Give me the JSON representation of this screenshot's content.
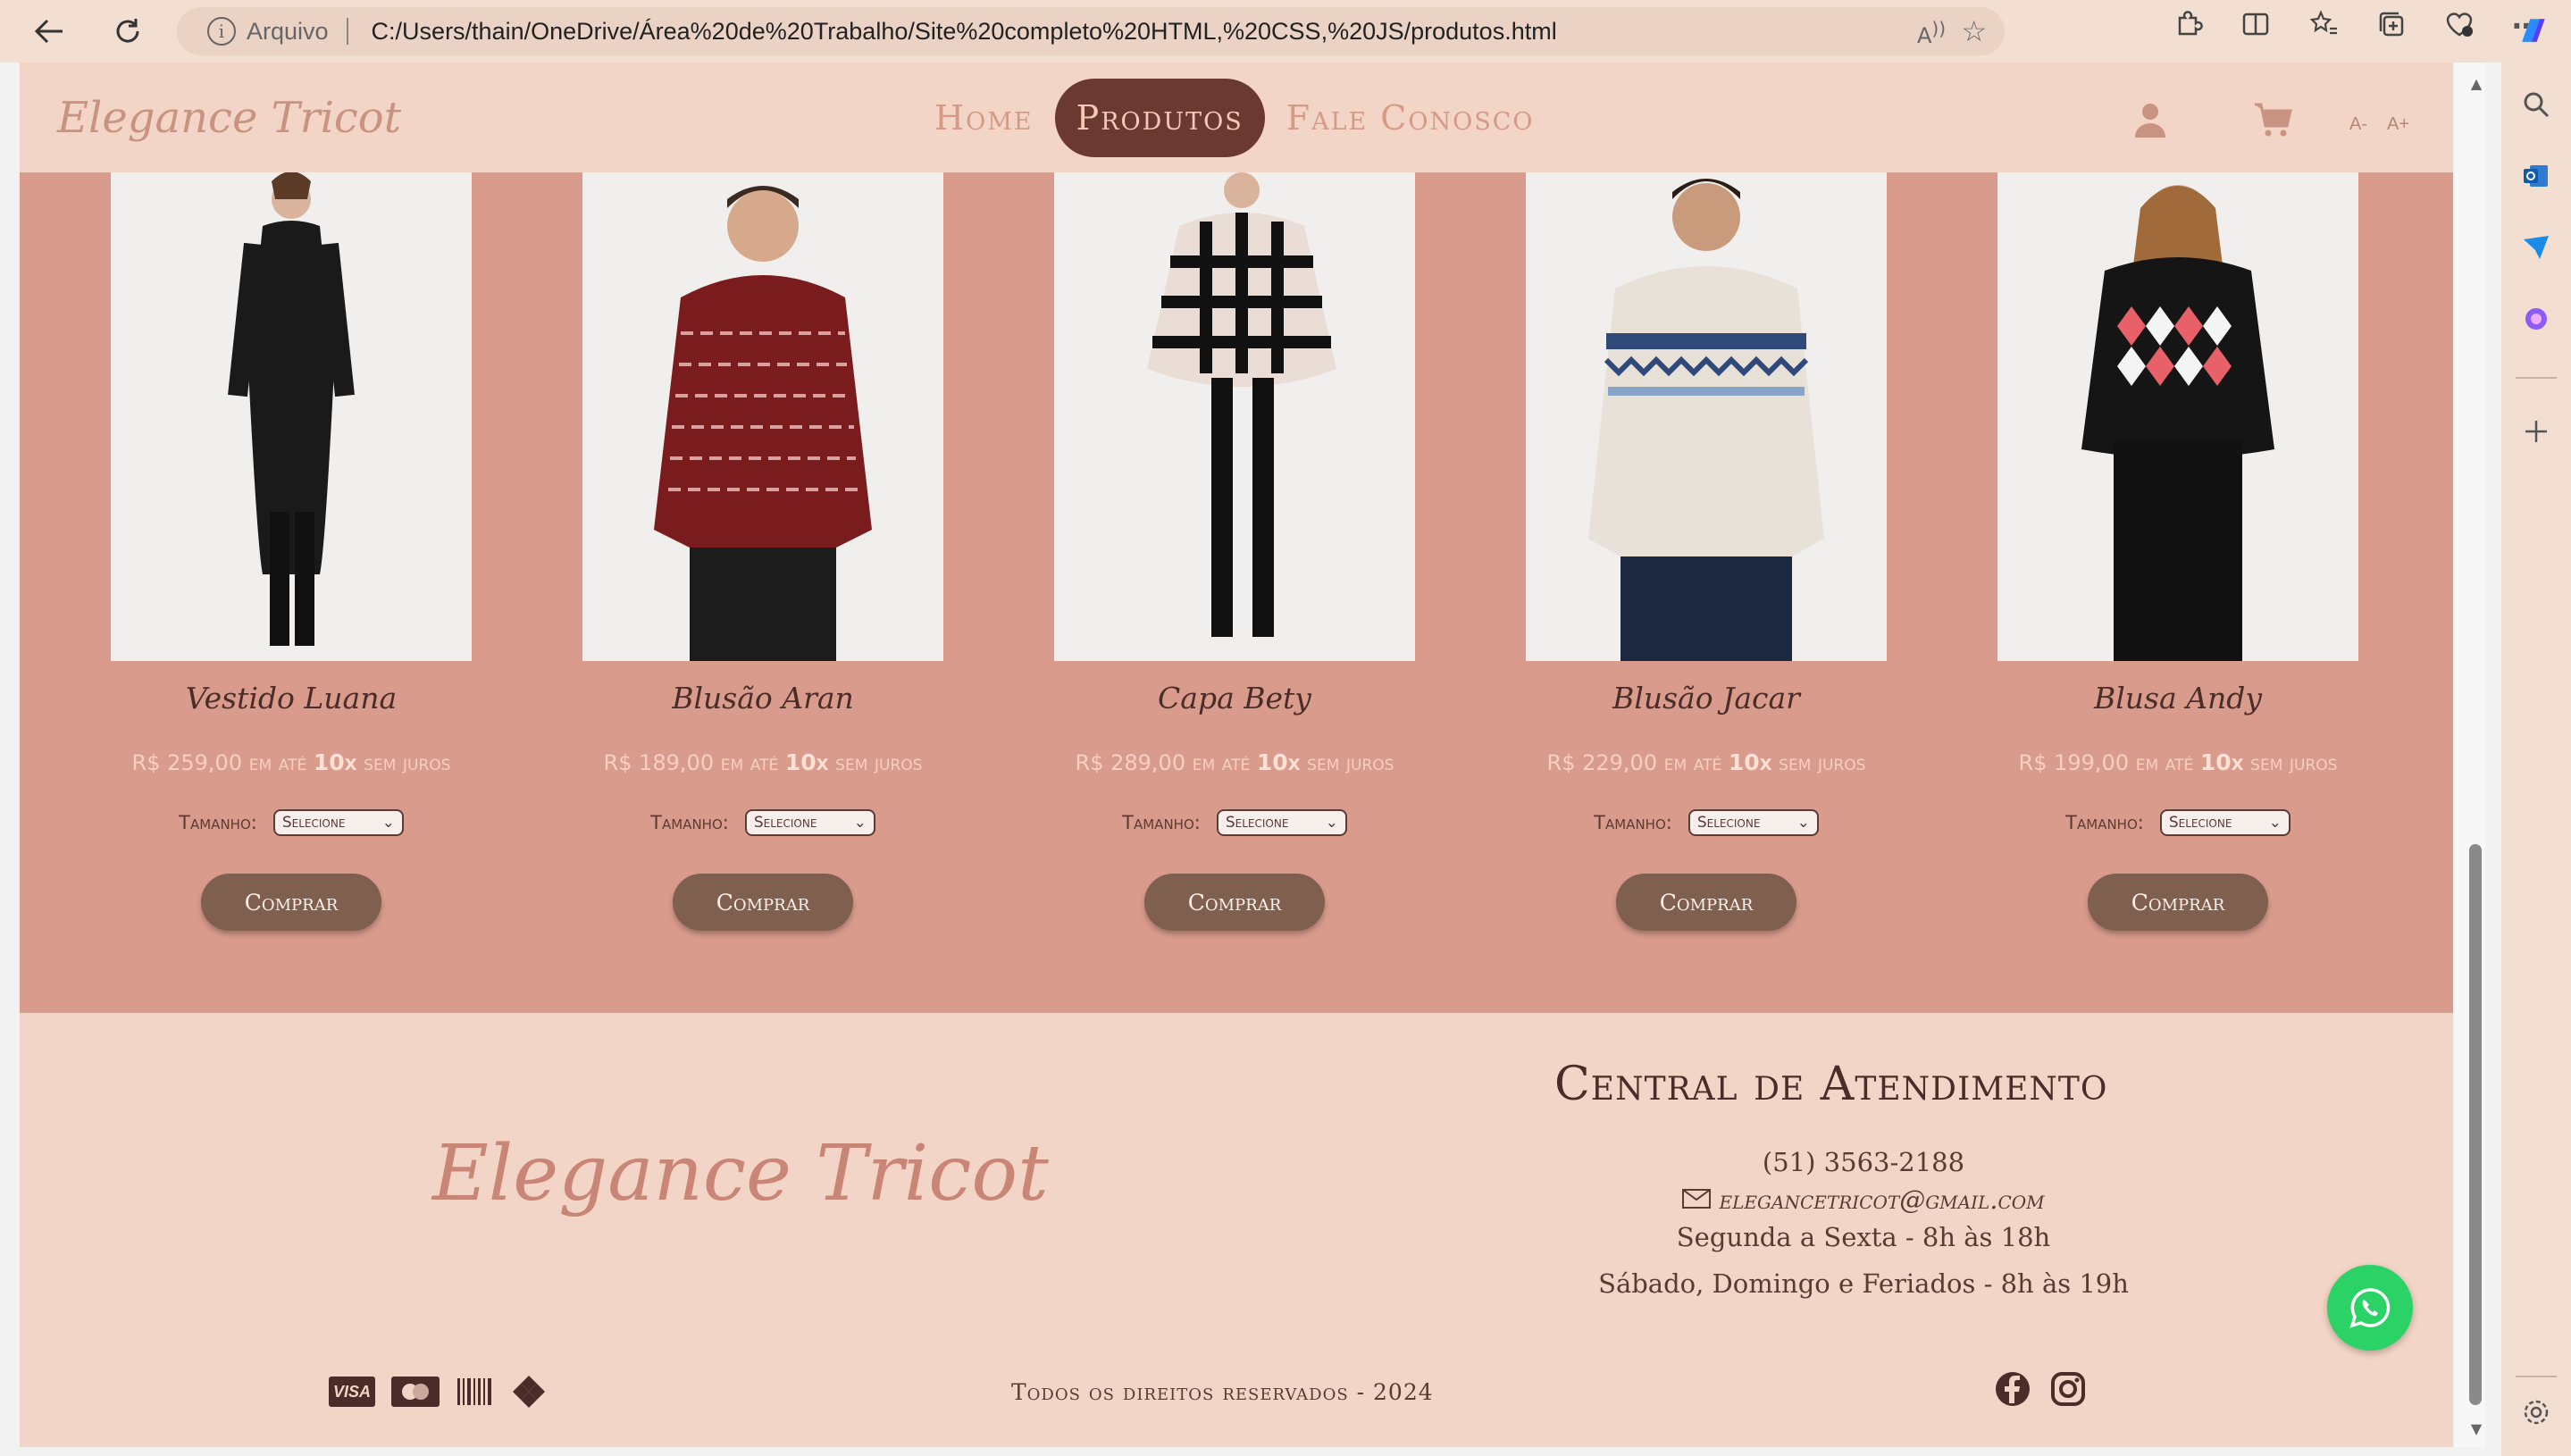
{
  "browser": {
    "address_label": "Arquivo",
    "url": "C:/Users/thain/OneDrive/Área%20de%20Trabalho/Site%20completo%20HTML,%20CSS,%20JS/produtos.html"
  },
  "header": {
    "logo": "Elegance Tricot",
    "nav": [
      {
        "label": "Home"
      },
      {
        "label": "Produtos"
      },
      {
        "label": "Fale Conosco"
      }
    ],
    "font_decrease": "A-",
    "font_increase": "A+"
  },
  "products": [
    {
      "name": "Vestido Luana",
      "price": "R$ 259,00",
      "installments_prefix": "em até",
      "installments": "10x",
      "installments_suffix": "sem juros",
      "size_label": "Tamanho:",
      "size_value": "Selecione",
      "buy_label": "Comprar"
    },
    {
      "name": "Blusão Aran",
      "price": "R$ 189,00",
      "installments_prefix": "em até",
      "installments": "10x",
      "installments_suffix": "sem juros",
      "size_label": "Tamanho:",
      "size_value": "Selecione",
      "buy_label": "Comprar"
    },
    {
      "name": "Capa Bety",
      "price": "R$ 289,00",
      "installments_prefix": "em até",
      "installments": "10x",
      "installments_suffix": "sem juros",
      "size_label": "Tamanho:",
      "size_value": "Selecione",
      "buy_label": "Comprar"
    },
    {
      "name": "Blusão Jacar",
      "price": "R$ 229,00",
      "installments_prefix": "em até",
      "installments": "10x",
      "installments_suffix": "sem juros",
      "size_label": "Tamanho:",
      "size_value": "Selecione",
      "buy_label": "Comprar"
    },
    {
      "name": "Blusa Andy",
      "price": "R$ 199,00",
      "installments_prefix": "em até",
      "installments": "10x",
      "installments_suffix": "sem juros",
      "size_label": "Tamanho:",
      "size_value": "Selecione",
      "buy_label": "Comprar"
    }
  ],
  "footer": {
    "logo": "Elegance Tricot",
    "support_title": "Central de Atendimento",
    "phone": "(51) 3563-2188",
    "email": "elegancetricot@gmail.com",
    "hours_weekday": "Segunda a Sexta - 8h às 18h",
    "hours_weekend": "Sábado, Domingo e Feriados - 8h às 19h",
    "copyright": "Todos os direitos reservados - 2024",
    "payment_icons": [
      "visa-icon",
      "mastercard-icon",
      "boleto-icon",
      "pix-icon"
    ],
    "visa_text": "VISA",
    "social_icons": [
      "facebook-icon",
      "instagram-icon"
    ]
  },
  "colors": {
    "header_bg": "#f2d5c6",
    "products_bg": "#d99b8c",
    "nav_active": "#6b3932",
    "buy_button": "#7f5f4d",
    "whatsapp": "#2bd366"
  }
}
